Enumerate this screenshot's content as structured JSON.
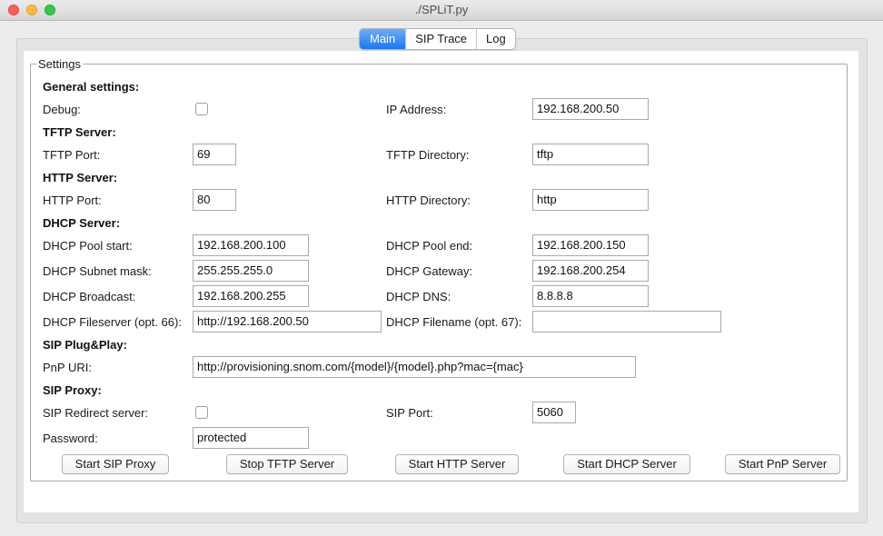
{
  "window": {
    "title": "./SPLiT.py",
    "colors": {
      "close": "#fc605c",
      "minimize": "#fdbc40",
      "maximize": "#34c84a"
    }
  },
  "tabs": [
    {
      "label": "Main",
      "active": true
    },
    {
      "label": "SIP Trace",
      "active": false
    },
    {
      "label": "Log",
      "active": false
    }
  ],
  "settings": {
    "legend": "Settings",
    "general": {
      "header": "General settings:",
      "debug_label": "Debug:",
      "debug_checked": false,
      "ip_label": "IP Address:",
      "ip_value": "192.168.200.50"
    },
    "tftp": {
      "header": "TFTP Server:",
      "port_label": "TFTP Port:",
      "port_value": "69",
      "dir_label": "TFTP Directory:",
      "dir_value": "tftp"
    },
    "http": {
      "header": "HTTP Server:",
      "port_label": "HTTP Port:",
      "port_value": "80",
      "dir_label": "HTTP Directory:",
      "dir_value": "http"
    },
    "dhcp": {
      "header": "DHCP Server:",
      "pool_start_label": "DHCP Pool start:",
      "pool_start_value": "192.168.200.100",
      "pool_end_label": "DHCP Pool end:",
      "pool_end_value": "192.168.200.150",
      "subnet_label": "DHCP Subnet mask:",
      "subnet_value": "255.255.255.0",
      "gateway_label": "DHCP Gateway:",
      "gateway_value": "192.168.200.254",
      "broadcast_label": "DHCP Broadcast:",
      "broadcast_value": "192.168.200.255",
      "dns_label": "DHCP DNS:",
      "dns_value": "8.8.8.8",
      "fileserver_label": "DHCP Fileserver (opt. 66):",
      "fileserver_value": "http://192.168.200.50",
      "filename_label": "DHCP Filename (opt. 67):",
      "filename_value": ""
    },
    "pnp": {
      "header": "SIP Plug&Play:",
      "uri_label": "PnP URI:",
      "uri_value": "http://provisioning.snom.com/{model}/{model}.php?mac={mac}"
    },
    "proxy": {
      "header": "SIP Proxy:",
      "redirect_label": "SIP Redirect server:",
      "redirect_checked": false,
      "port_label": "SIP Port:",
      "port_value": "5060",
      "password_label": "Password:",
      "password_value": "protected"
    }
  },
  "buttons": {
    "sip_proxy": "Start SIP Proxy",
    "tftp": "Stop TFTP Server",
    "http": "Start HTTP Server",
    "dhcp": "Start DHCP Server",
    "pnp": "Start PnP Server"
  }
}
